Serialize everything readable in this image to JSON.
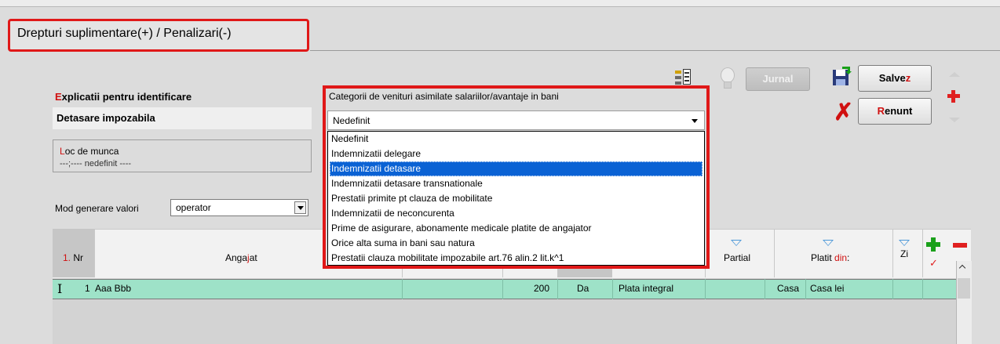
{
  "title": "Drepturi suplimentare(+) / Penalizari(-)",
  "explicatii": {
    "label_accent": "E",
    "label_rest": "xplicatii pentru identificare",
    "value": "Detasare impozabila"
  },
  "loc_munca": {
    "label_accent": "L",
    "label_rest": "oc de munca",
    "value": "---;---- nedefinit ----"
  },
  "mod_generare": {
    "label": "Mod generare valori",
    "value": "operator"
  },
  "categorii": {
    "label": "Categorii de venituri asimilate salariilor/avantaje in bani",
    "selected": "Nedefinit",
    "options": [
      "Nedefinit",
      "Indemnizatii delegare",
      "Indemnizatii detasare",
      "Indemnizatii detasare transnationale",
      "Prestatii primite pt clauza de mobilitate",
      "Indemnizatii de neconcurenta",
      "Prime de asigurare, abonamente medicale platite de angajator",
      "Orice alta suma in bani sau natura",
      "Prestatii clauza mobilitate impozabile art.76 alin.2 lit.k^1"
    ],
    "highlighted_index": 2
  },
  "toolbar": {
    "jurnal": "Jurnal",
    "salvez_a": "Salve",
    "salvez_b": "z",
    "renunt_a": "R",
    "renunt_b": "enunt"
  },
  "grid": {
    "headers": {
      "nr_a": "1.",
      "nr_b": " Nr",
      "angajat_a": "Anga",
      "angajat_b": "j",
      "angajat_c": "at",
      "partial": "Partial",
      "platit_a": "Platit ",
      "platit_b": "din",
      "platit_c": ":",
      "zi": "Zi"
    },
    "rows": [
      {
        "nr": "1",
        "angajat": "Aaa Bbb",
        "suma": "200",
        "da": "Da",
        "plata": "Plata integral",
        "casa": "Casa",
        "casa_lei": "Casa lei"
      }
    ]
  },
  "colors": {
    "accent_red": "#e01818",
    "selection_blue": "#0a62d4",
    "row_green": "#9ee2c8"
  }
}
